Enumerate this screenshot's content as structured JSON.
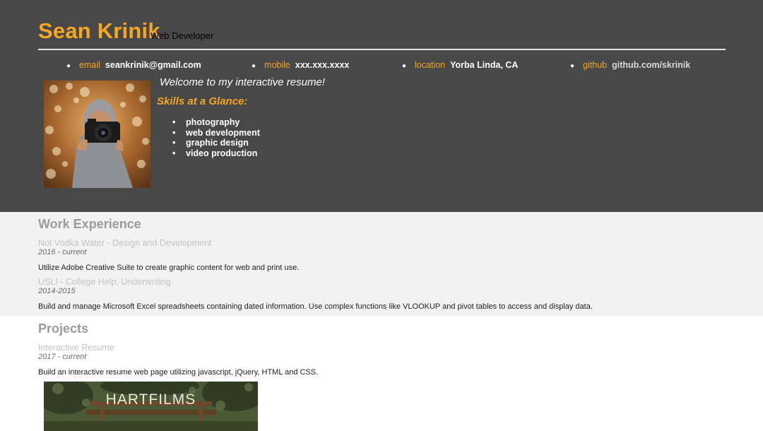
{
  "header": {
    "name": "Sean Krinik",
    "role": "Web Developer",
    "contacts": [
      {
        "key": "email",
        "value": "seankrinik@gmail.com"
      },
      {
        "key": "mobile",
        "value": "xxx.xxx.xxxx"
      },
      {
        "key": "location",
        "value": "Yorba Linda, CA"
      },
      {
        "key": "github",
        "value": "github.com/skrinik"
      }
    ],
    "welcome": "Welcome to my interactive resume!",
    "skills_title": "Skills at a Glance:",
    "skills": [
      "photography",
      "web development",
      "graphic design",
      "video production"
    ]
  },
  "work": {
    "title": "Work Experience",
    "jobs": [
      {
        "employer": "Not Vodka Water - Design and Development",
        "dates": "2016 - current",
        "description": "Utilize Adobe Creative Suite to create graphic content for web and print use."
      },
      {
        "employer": "USLI - College Help, Underwriting",
        "dates": "2014-2015",
        "description": "Build and manage Microsoft Excel spreadsheets containing dated information. Use complex functions like VLOOKUP and pivot tables to access and display data."
      }
    ]
  },
  "projects": {
    "title": "Projects",
    "items": [
      {
        "title": "Interactive Resume",
        "dates": "2017 - current",
        "description": "Build an interactive resume web page utilizing javascript, jQuery, HTML and CSS.",
        "image_logo": "HARTFILMS"
      }
    ]
  },
  "colors": {
    "accent": "#f5a623",
    "header_bg": "#484848",
    "work_bg": "#f2f2f2"
  }
}
